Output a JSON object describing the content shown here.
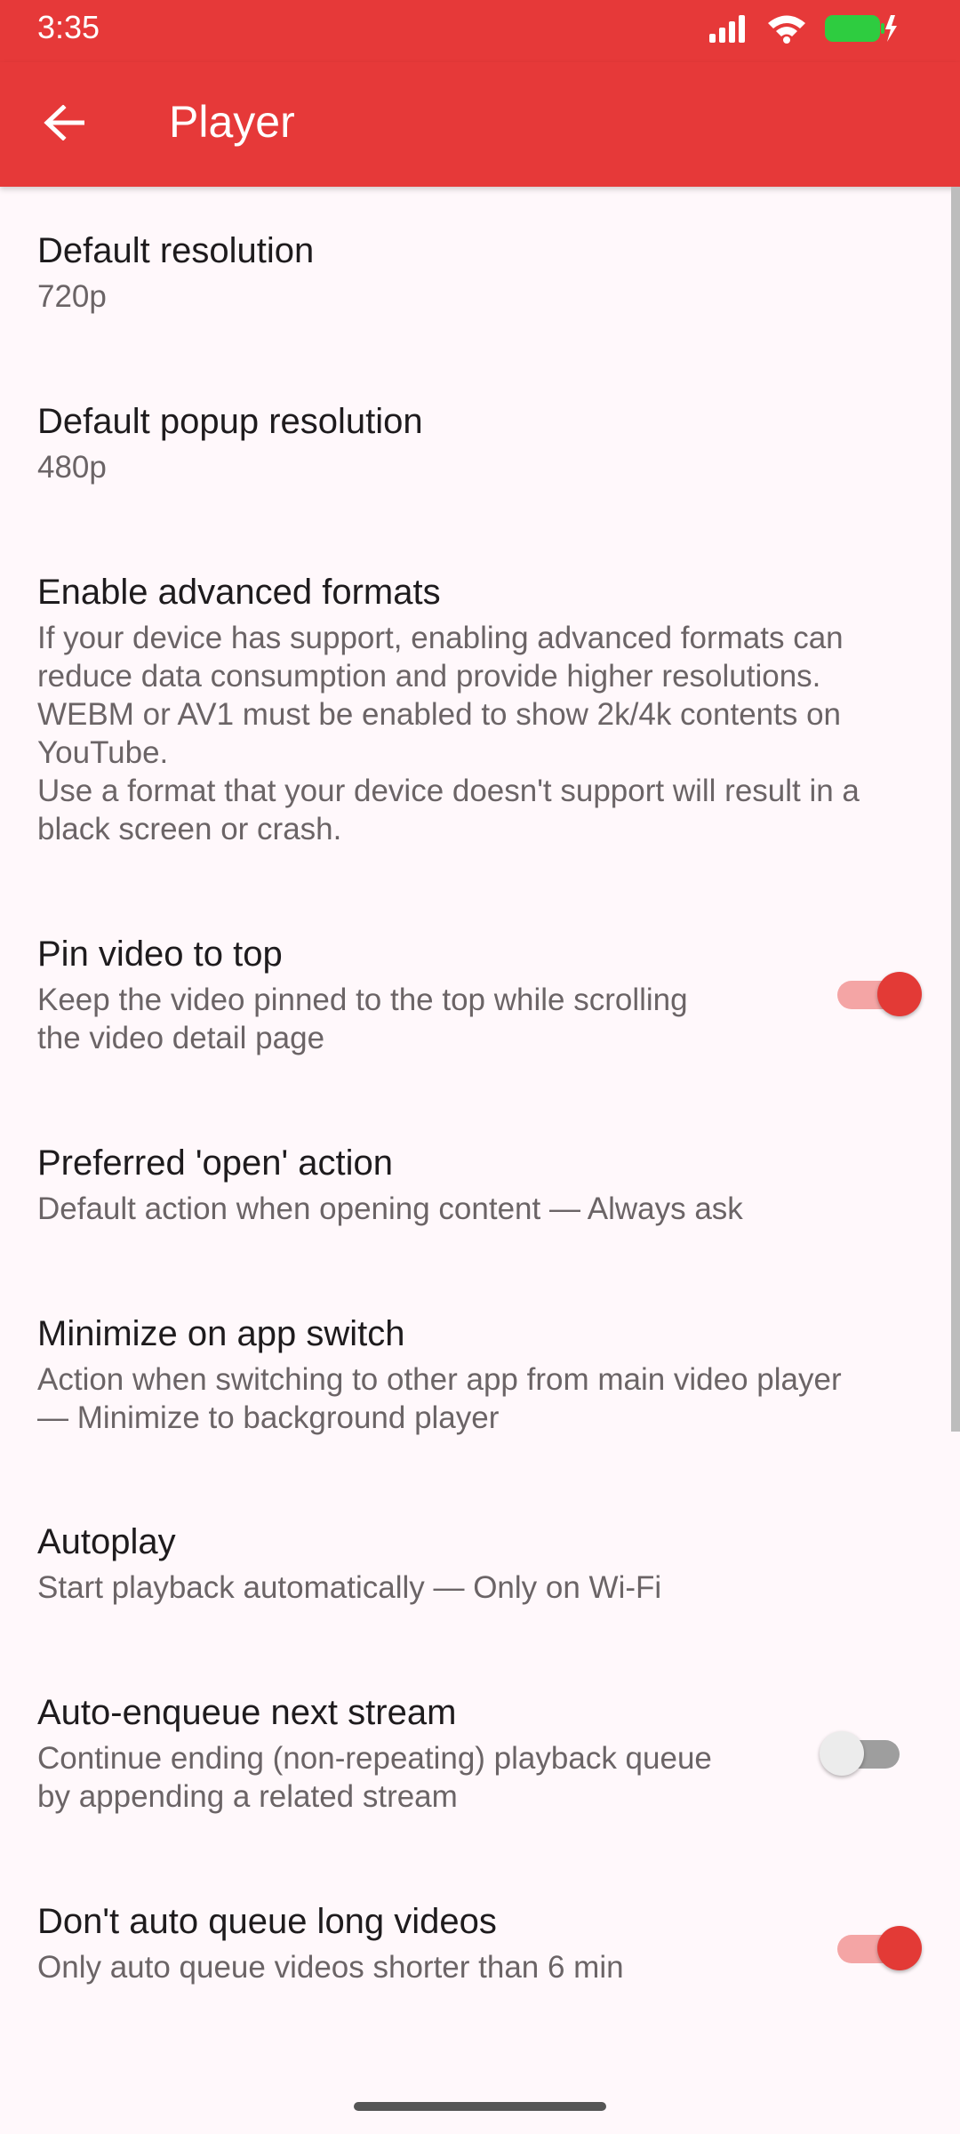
{
  "status_bar": {
    "time": "3:35",
    "icons": [
      "signal-icon",
      "wifi-icon",
      "battery-charging-icon"
    ],
    "battery_color": "#2ECC40"
  },
  "app_bar": {
    "title": "Player",
    "background": "#E63939",
    "back_icon": "arrow-back-icon"
  },
  "prefs": [
    {
      "title": "Default resolution",
      "summary": "720p"
    },
    {
      "title": "Default popup resolution",
      "summary": "480p"
    },
    {
      "title": "Enable advanced formats",
      "summary": "If your device has support, enabling advanced formats can\nreduce data consumption and provide higher resolutions.\nWEBM or AV1 must be enabled to show 2k/4k contents on\nYouTube.\nUse a format that your device doesn't support will result in a\nblack screen or crash."
    },
    {
      "title": "Pin video to top",
      "summary": "Keep the video pinned to the top while scrolling\nthe video detail page",
      "switch": true
    },
    {
      "title": "Preferred 'open' action",
      "summary": "Default action when opening content — Always ask"
    },
    {
      "title": "Minimize on app switch",
      "summary": "Action when switching to other app from main video player\n— Minimize to background player"
    },
    {
      "title": "Autoplay",
      "summary": "Start playback automatically — Only on Wi-Fi"
    },
    {
      "title": "Auto-enqueue next stream",
      "summary": "Continue ending (non-repeating) playback queue\nby appending a related stream",
      "switch": false
    },
    {
      "title": "Don't auto queue long videos",
      "summary": "Only auto queue videos shorter than 6 min",
      "switch": true
    }
  ],
  "colors": {
    "accent": "#E63939",
    "switch_on": "#E33A36",
    "background": "#FFF8FB"
  }
}
